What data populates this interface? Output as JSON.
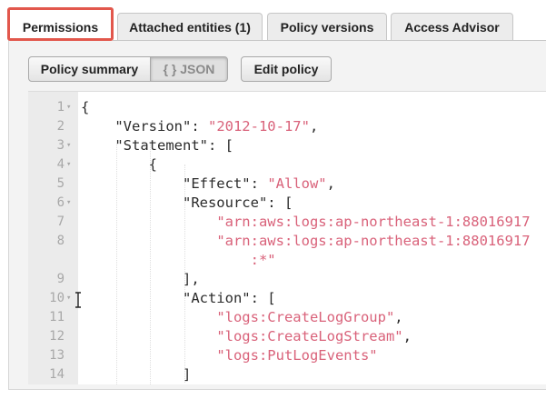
{
  "tabs": [
    {
      "label": "Permissions",
      "active": true
    },
    {
      "label": "Attached entities (1)",
      "active": false
    },
    {
      "label": "Policy versions",
      "active": false
    },
    {
      "label": "Access Advisor",
      "active": false
    }
  ],
  "toolbar": {
    "policy_summary_label": "Policy summary",
    "json_label": "{ } JSON",
    "edit_policy_label": "Edit policy"
  },
  "editor": {
    "lines": [
      {
        "num": "1",
        "fold": "▾",
        "parts": [
          {
            "t": "{",
            "c": "p"
          }
        ]
      },
      {
        "num": "2",
        "fold": "",
        "parts": [
          {
            "t": "    \"Version\": ",
            "c": "p"
          },
          {
            "t": "\"2012-10-17\"",
            "c": "s"
          },
          {
            "t": ",",
            "c": "p"
          }
        ]
      },
      {
        "num": "3",
        "fold": "▾",
        "parts": [
          {
            "t": "    \"Statement\": [",
            "c": "p"
          }
        ]
      },
      {
        "num": "4",
        "fold": "▾",
        "parts": [
          {
            "t": "        {",
            "c": "p"
          }
        ]
      },
      {
        "num": "5",
        "fold": "",
        "parts": [
          {
            "t": "            \"Effect\": ",
            "c": "p"
          },
          {
            "t": "\"Allow\"",
            "c": "s"
          },
          {
            "t": ",",
            "c": "p"
          }
        ]
      },
      {
        "num": "6",
        "fold": "▾",
        "parts": [
          {
            "t": "            \"Resource\": [",
            "c": "p"
          }
        ]
      },
      {
        "num": "7",
        "fold": "",
        "parts": [
          {
            "t": "                ",
            "c": "p"
          },
          {
            "t": "\"arn:aws:logs:ap-northeast-1:88016917",
            "c": "s"
          }
        ]
      },
      {
        "num": "8",
        "fold": "",
        "parts": [
          {
            "t": "                ",
            "c": "p"
          },
          {
            "t": "\"arn:aws:logs:ap-northeast-1:88016917",
            "c": "s"
          }
        ]
      },
      {
        "num": "",
        "fold": "",
        "parts": [
          {
            "t": "                    ",
            "c": "p"
          },
          {
            "t": ":*\"",
            "c": "s"
          }
        ]
      },
      {
        "num": "9",
        "fold": "",
        "parts": [
          {
            "t": "            ],",
            "c": "p"
          }
        ]
      },
      {
        "num": "10",
        "fold": "▾",
        "parts": [
          {
            "t": "            \"Action\": [",
            "c": "p"
          }
        ]
      },
      {
        "num": "11",
        "fold": "",
        "parts": [
          {
            "t": "                ",
            "c": "p"
          },
          {
            "t": "\"logs:CreateLogGroup\"",
            "c": "s"
          },
          {
            "t": ",",
            "c": "p"
          }
        ]
      },
      {
        "num": "12",
        "fold": "",
        "parts": [
          {
            "t": "                ",
            "c": "p"
          },
          {
            "t": "\"logs:CreateLogStream\"",
            "c": "s"
          },
          {
            "t": ",",
            "c": "p"
          }
        ]
      },
      {
        "num": "13",
        "fold": "",
        "parts": [
          {
            "t": "                ",
            "c": "p"
          },
          {
            "t": "\"logs:PutLogEvents\"",
            "c": "s"
          }
        ]
      },
      {
        "num": "14",
        "fold": "",
        "parts": [
          {
            "t": "            ]",
            "c": "p"
          }
        ]
      }
    ]
  },
  "colors": {
    "highlight": "#e2574c",
    "string": "#d9627a"
  }
}
